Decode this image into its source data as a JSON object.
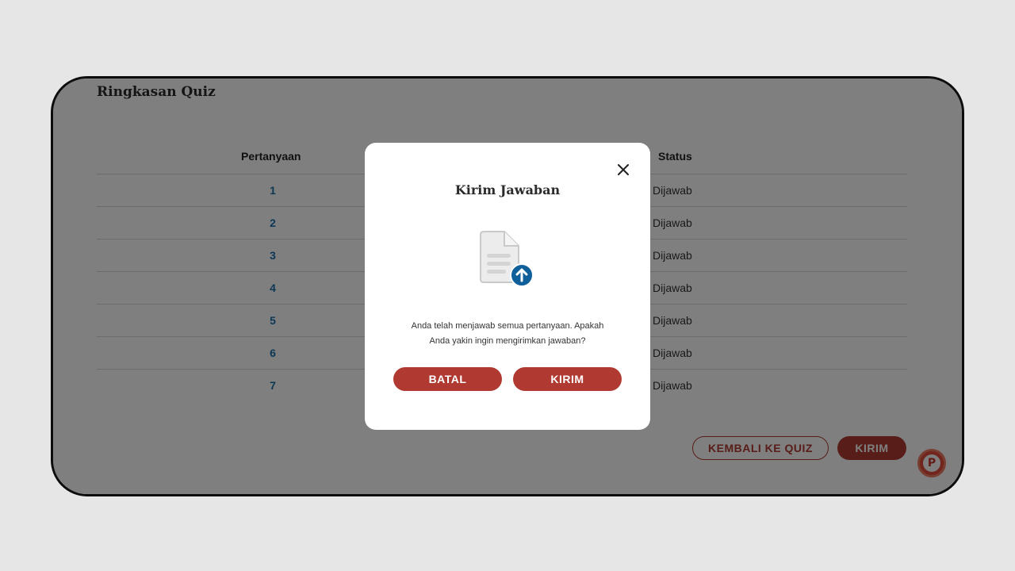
{
  "page": {
    "title": "Ringkasan Quiz"
  },
  "table": {
    "headers": {
      "question": "Pertanyaan",
      "status": "Status"
    },
    "rows": [
      {
        "number": "1",
        "status": "Dijawab"
      },
      {
        "number": "2",
        "status": "Dijawab"
      },
      {
        "number": "3",
        "status": "Dijawab"
      },
      {
        "number": "4",
        "status": "Dijawab"
      },
      {
        "number": "5",
        "status": "Dijawab"
      },
      {
        "number": "6",
        "status": "Dijawab"
      },
      {
        "number": "7",
        "status": "Dijawab"
      }
    ]
  },
  "actions": {
    "back_label": "KEMBALI KE QUIZ",
    "submit_label": "KIRIM",
    "help_icon_letter": "P"
  },
  "modal": {
    "title": "Kirim Jawaban",
    "message_line1": "Anda telah menjawab semua pertanyaan. Apakah",
    "message_line2": "Anda yakin ingin mengirimkan jawaban?",
    "cancel_label": "BATAL",
    "confirm_label": "KIRIM",
    "close_icon": "close-icon",
    "illustration_icon": "document-upload-icon"
  },
  "colors": {
    "accent": "#b03a31",
    "link_number": "#1a6fa8",
    "upload_badge": "#0f5f9a",
    "overlay": "rgba(0,0,0,0.5)"
  }
}
